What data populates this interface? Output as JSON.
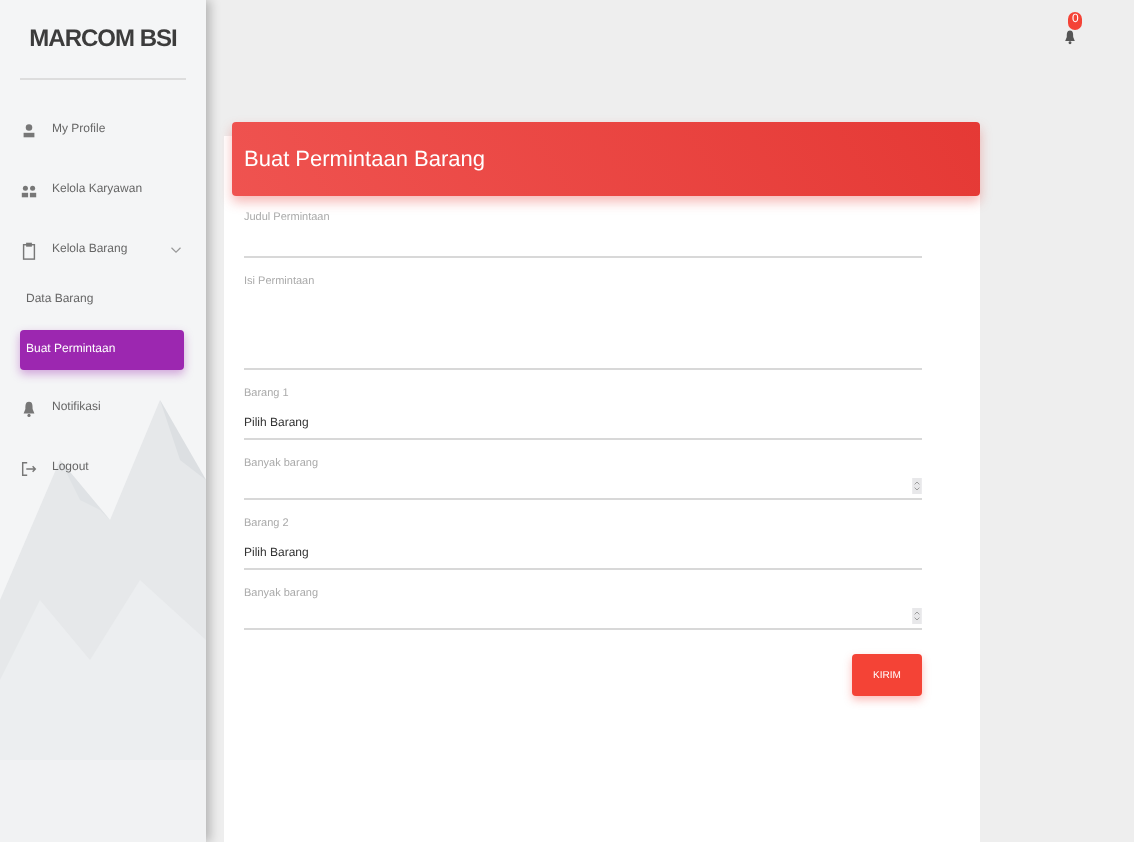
{
  "sidebar": {
    "brand": "MARCOM BSI",
    "items": [
      {
        "label": "My Profile"
      },
      {
        "label": "Kelola Karyawan"
      },
      {
        "label": "Kelola Barang",
        "expanded": true,
        "children": [
          {
            "label": "Data Barang",
            "selected": false
          },
          {
            "label": "Buat Permintaan",
            "selected": true
          }
        ]
      },
      {
        "label": "Notifikasi"
      },
      {
        "label": "Logout"
      }
    ]
  },
  "topbar": {
    "notification_count": "0"
  },
  "card": {
    "title": "Buat Permintaan Barang",
    "fields": [
      {
        "kind": "text",
        "label": "Judul Permintaan"
      },
      {
        "kind": "textarea",
        "label": "Isi Permintaan"
      },
      {
        "kind": "select",
        "label": "Barang 1",
        "value": "Pilih Barang"
      },
      {
        "kind": "number",
        "label": "Banyak barang"
      },
      {
        "kind": "select",
        "label": "Barang 2",
        "value": "Pilih Barang"
      },
      {
        "kind": "number",
        "label": "Banyak barang"
      }
    ],
    "submit": "KIRIM"
  }
}
